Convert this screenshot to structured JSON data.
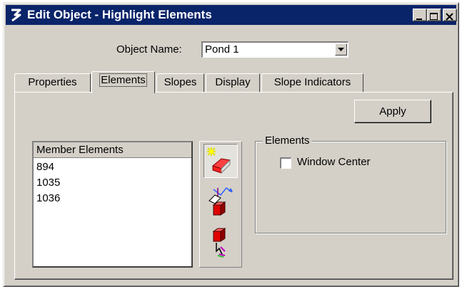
{
  "window": {
    "title": "Edit Object - Highlight Elements",
    "controls": {
      "minimize": "minimize",
      "maximize": "maximize",
      "close": "close"
    }
  },
  "object_name": {
    "label": "Object Name:",
    "value": "Pond 1"
  },
  "tabs": [
    {
      "label": "Properties",
      "active": false
    },
    {
      "label": "Elements",
      "active": true
    },
    {
      "label": "Slopes",
      "active": false
    },
    {
      "label": "Display",
      "active": false
    },
    {
      "label": "Slope Indicators",
      "active": false
    }
  ],
  "apply_label": "Apply",
  "member_elements": {
    "header": "Member Elements",
    "items": [
      "894",
      "1035",
      "1036"
    ]
  },
  "tool_icons": [
    "highlight-element-icon",
    "add-element-icon",
    "remove-element-icon"
  ],
  "elements_group": {
    "legend": "Elements",
    "window_center_label": "Window Center",
    "window_center_checked": false
  },
  "colors": {
    "titlebar": "#0a246a",
    "face": "#d4d0c8"
  }
}
